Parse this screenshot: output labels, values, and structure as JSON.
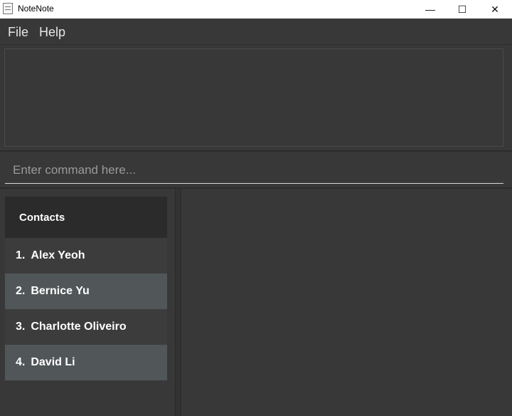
{
  "window": {
    "title": "NoteNote",
    "minimize_glyph": "—",
    "maximize_glyph": "☐",
    "close_glyph": "✕"
  },
  "menu": {
    "file": "File",
    "help": "Help"
  },
  "command": {
    "value": "",
    "placeholder": "Enter command here..."
  },
  "contacts": {
    "header": "Contacts",
    "items": [
      {
        "index": "1.",
        "name": "Alex Yeoh"
      },
      {
        "index": "2.",
        "name": "Bernice Yu"
      },
      {
        "index": "3.",
        "name": "Charlotte Oliveiro"
      },
      {
        "index": "4.",
        "name": "David Li"
      }
    ]
  },
  "colors": {
    "background": "#383838",
    "header_bg": "#2b2b2b",
    "row_odd": "#3c3c3c",
    "row_even": "#515658"
  }
}
